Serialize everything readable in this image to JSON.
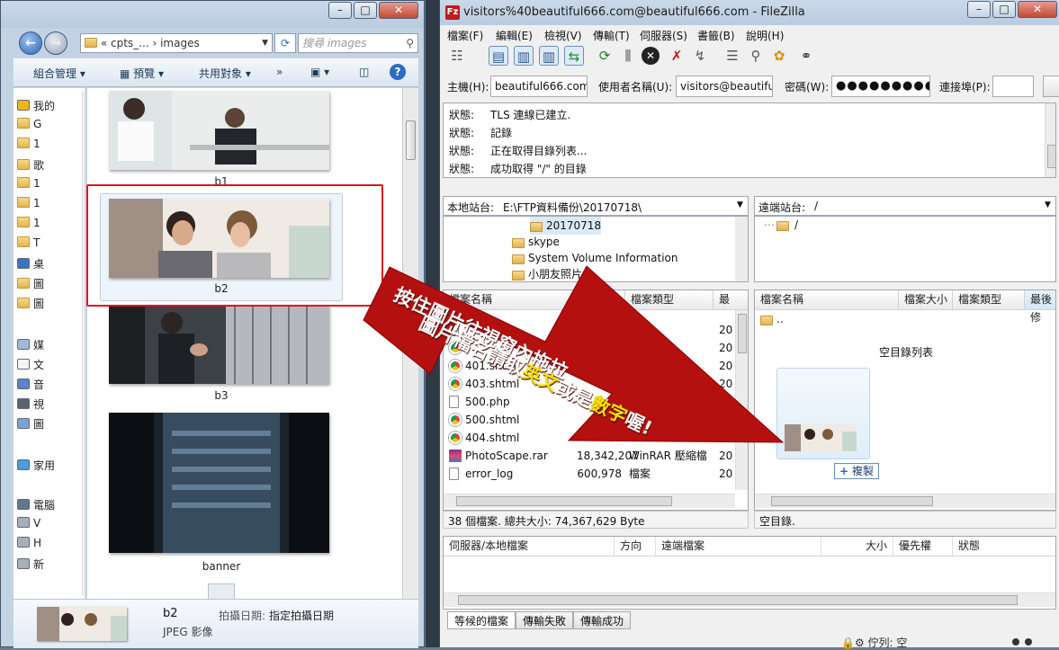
{
  "explorer": {
    "address_prefix": "«",
    "address_parent": "cpts_...",
    "address_sep": "›",
    "address_current": "images",
    "search_placeholder": "搜尋 images",
    "toolbar": {
      "organize": "組合管理",
      "preview": "預覽",
      "share": "共用對象",
      "more": "»"
    },
    "nav_items": [
      {
        "label": "我的",
        "icon": "star-icon"
      },
      {
        "label": "G",
        "icon": "folder-icon"
      },
      {
        "label": "1",
        "icon": "folder-icon"
      },
      {
        "label": "歌",
        "icon": "folder-icon"
      },
      {
        "label": "1",
        "icon": "folder-icon"
      },
      {
        "label": "1",
        "icon": "folder-icon"
      },
      {
        "label": "1",
        "icon": "folder-icon"
      },
      {
        "label": "T",
        "icon": "folder-icon"
      },
      {
        "label": "桌",
        "icon": "desktop-icon"
      },
      {
        "label": "圖",
        "icon": "folder-icon"
      },
      {
        "label": "圖",
        "icon": "folder-icon"
      },
      {
        "label": "媒",
        "icon": "library-icon"
      },
      {
        "label": "文",
        "icon": "document-icon"
      },
      {
        "label": "音",
        "icon": "music-icon"
      },
      {
        "label": "視",
        "icon": "video-icon"
      },
      {
        "label": "圖",
        "icon": "picture-icon"
      },
      {
        "label": "家用",
        "icon": "homegroup-icon"
      },
      {
        "label": "電腦",
        "icon": "computer-icon"
      },
      {
        "label": "V",
        "icon": "drive-icon"
      },
      {
        "label": "H",
        "icon": "drive-icon"
      },
      {
        "label": "新",
        "icon": "drive-icon"
      }
    ],
    "files": [
      "b1",
      "b2",
      "b3",
      "banner"
    ],
    "details": {
      "name": "b2",
      "type": "JPEG 影像",
      "date_label": "拍攝日期:",
      "date_value": "指定拍攝日期"
    }
  },
  "filezilla": {
    "title": "visitors%40beautiful666.com@beautiful666.com - FileZilla",
    "menu": [
      "檔案(F)",
      "編輯(E)",
      "檢視(V)",
      "傳輸(T)",
      "伺服器(S)",
      "書籤(B)",
      "說明(H)"
    ],
    "quickconnect": {
      "host_label": "主機(H):",
      "host": "beautiful666.com",
      "user_label": "使用者名稱(U):",
      "user": "visitors@beautiful6",
      "pass_label": "密碼(W):",
      "pass": "●●●●●●●●●",
      "port_label": "連接埠(P):",
      "port": ""
    },
    "log": [
      {
        "label": "狀態:",
        "text": "TLS 連線已建立."
      },
      {
        "label": "狀態:",
        "text": "記錄"
      },
      {
        "label": "狀態:",
        "text": "正在取得目錄列表..."
      },
      {
        "label": "狀態:",
        "text": "成功取得 \"/\" 的目錄"
      }
    ],
    "local_site_label": "本地站台:",
    "local_path": "E:\\FTP資料備份\\20170718\\",
    "local_tree": [
      "20170718",
      "skype",
      "System Volume Information",
      "小朋友照片"
    ],
    "remote_site_label": "遠端站台:",
    "remote_path": "/",
    "remote_tree": [
      "/"
    ],
    "local_columns": [
      "檔案名稱",
      "檔案大小",
      "檔案類型",
      "最"
    ],
    "local_files": [
      {
        "name": "",
        "size": "",
        "type": "式",
        "date": "20",
        "icon": "file"
      },
      {
        "name": "",
        "size": "",
        "type": "HTM...",
        "date": "20",
        "icon": "chrome"
      },
      {
        "name": "401.shtml",
        "size": "",
        "type": "HTM...",
        "date": "20",
        "icon": "chrome"
      },
      {
        "name": "403.shtml",
        "size": "",
        "type": "",
        "date": "20",
        "icon": "chrome"
      },
      {
        "name": "500.php",
        "size": "",
        "type": "",
        "date": "20",
        "icon": "file"
      },
      {
        "name": "500.shtml",
        "size": "",
        "type": "",
        "date": "20",
        "icon": "chrome"
      },
      {
        "name": "404.shtml",
        "size": "85",
        "type": "Chrome HTM...",
        "date": "20",
        "icon": "chrome"
      },
      {
        "name": "PhotoScape.rar",
        "size": "18,342,207",
        "type": "WinRAR 壓縮檔",
        "date": "20",
        "icon": "rar"
      },
      {
        "name": "error_log",
        "size": "600,978",
        "type": "檔案",
        "date": "20",
        "icon": "file"
      }
    ],
    "local_status": "38 個檔案. 總共大小: 74,367,629 Byte",
    "remote_columns": [
      "檔案名稱",
      "檔案大小",
      "檔案類型",
      "最後修"
    ],
    "remote_parent": "..",
    "remote_empty": "空目錄列表",
    "remote_status": "空目錄.",
    "copy_tooltip": "複製",
    "queue_columns": [
      "伺服器/本地檔案",
      "方向",
      "遠端檔案",
      "大小",
      "優先權",
      "狀態"
    ],
    "queue_tabs": [
      "等候的檔案",
      "傳輸失敗",
      "傳輸成功"
    ],
    "bottom_status": "佇列: 空"
  },
  "annotation": {
    "line1": "按住圖片往視窗內拖拉",
    "line2_a": "圖片檔名請取",
    "line2_b": "英文",
    "line2_c": "或是",
    "line2_d": "數字",
    "line2_e": "喔!",
    "highlight_color": "#f5e10c",
    "arrow_color": "#b3100f"
  }
}
